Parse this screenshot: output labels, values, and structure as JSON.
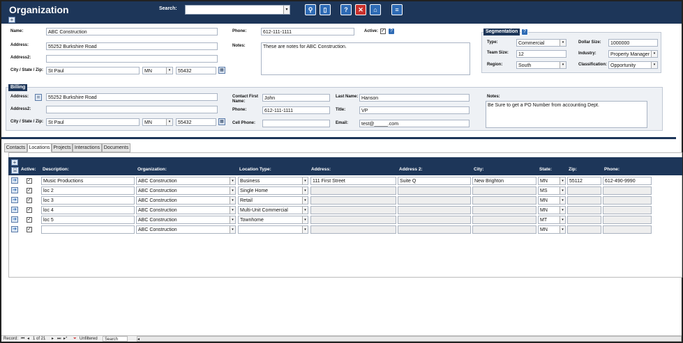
{
  "header": {
    "title": "Organization",
    "search_label": "Search:",
    "search_value": ""
  },
  "org": {
    "name_label": "Name:",
    "name": "ABC Construction",
    "address_label": "Address:",
    "address": "55252 Burkshire Road",
    "address2_label": "Address2:",
    "address2": "",
    "csz_label": "City / State / Zip:",
    "city": "St Paul",
    "state": "MN",
    "zip": "55432",
    "phone_label": "Phone:",
    "phone": "612-111-1111",
    "active_label": "Active:",
    "notes_label": "Notes:",
    "notes": "These are notes for ABC Construction."
  },
  "segmentation": {
    "title": "Segmentation",
    "type_label": "Type:",
    "type": "Commercial",
    "dollar_label": "Dollar Size:",
    "dollar": "1000000",
    "team_label": "Team Size:",
    "team": "12",
    "industry_label": "Industry:",
    "industry": "Property Manager",
    "region_label": "Region:",
    "region": "South",
    "class_label": "Classification:",
    "classification": "Opportunity"
  },
  "billing": {
    "title": "Billing",
    "address_label": "Address:",
    "address": "55252 Burkshire Road",
    "address2_label": "Address2:",
    "address2": "",
    "csz_label": "City / State / Zip:",
    "city": "St Paul",
    "state": "MN",
    "zip": "55432",
    "contact_first_label": "Contact First Name:",
    "contact_first": "John",
    "last_name_label": "Last Name:",
    "last_name": "Hanson",
    "phone_label": "Phone:",
    "phone": "612-111-1111",
    "title_label": "Title:",
    "title_value": "VP",
    "cell_label": "Cell Phone:",
    "cell": "",
    "email_label": "Email:",
    "email": "test@_____.com",
    "notes_label": "Notes:",
    "notes": "Be Sure to get a PO Number from accounting Dept."
  },
  "tabs": [
    "Contacts",
    "Locations",
    "Projects",
    "Interactions",
    "Documents"
  ],
  "grid": {
    "headers": {
      "active": "Active:",
      "description": "Description:",
      "organization": "Organization:",
      "location_type": "Location Type:",
      "address": "Address:",
      "address2": "Address 2:",
      "city": "City:",
      "state": "State:",
      "zip": "Zip:",
      "phone": "Phone:"
    },
    "rows": [
      {
        "description": "Music Productions",
        "organization": "ABC Construction",
        "location_type": "Business",
        "address": "111 First Street",
        "address2": "Suite Q",
        "city": "New Brighton",
        "state": "MN",
        "zip": "55112",
        "phone": "612-490-9990"
      },
      {
        "description": "loc 2",
        "organization": "ABC Construction",
        "location_type": "Single Home",
        "address": "",
        "address2": "",
        "city": "",
        "state": "MS",
        "zip": "",
        "phone": ""
      },
      {
        "description": "loc 3",
        "organization": "ABC Construction",
        "location_type": "Retail",
        "address": "",
        "address2": "",
        "city": "",
        "state": "MN",
        "zip": "",
        "phone": ""
      },
      {
        "description": "loc 4",
        "organization": "ABC Construction",
        "location_type": "Multi-Unit Commercial",
        "address": "",
        "address2": "",
        "city": "",
        "state": "MN",
        "zip": "",
        "phone": ""
      },
      {
        "description": "loc 5",
        "organization": "ABC Construction",
        "location_type": "Townhome",
        "address": "",
        "address2": "",
        "city": "",
        "state": "MT",
        "zip": "",
        "phone": ""
      },
      {
        "description": "",
        "organization": "ABC Construction",
        "location_type": "",
        "address": "",
        "address2": "",
        "city": "",
        "state": "MN",
        "zip": "",
        "phone": ""
      }
    ]
  },
  "statusbar": {
    "record_label": "Record:",
    "record_pos": "1 of 21",
    "filter": "Unfiltered",
    "search": "Search"
  }
}
